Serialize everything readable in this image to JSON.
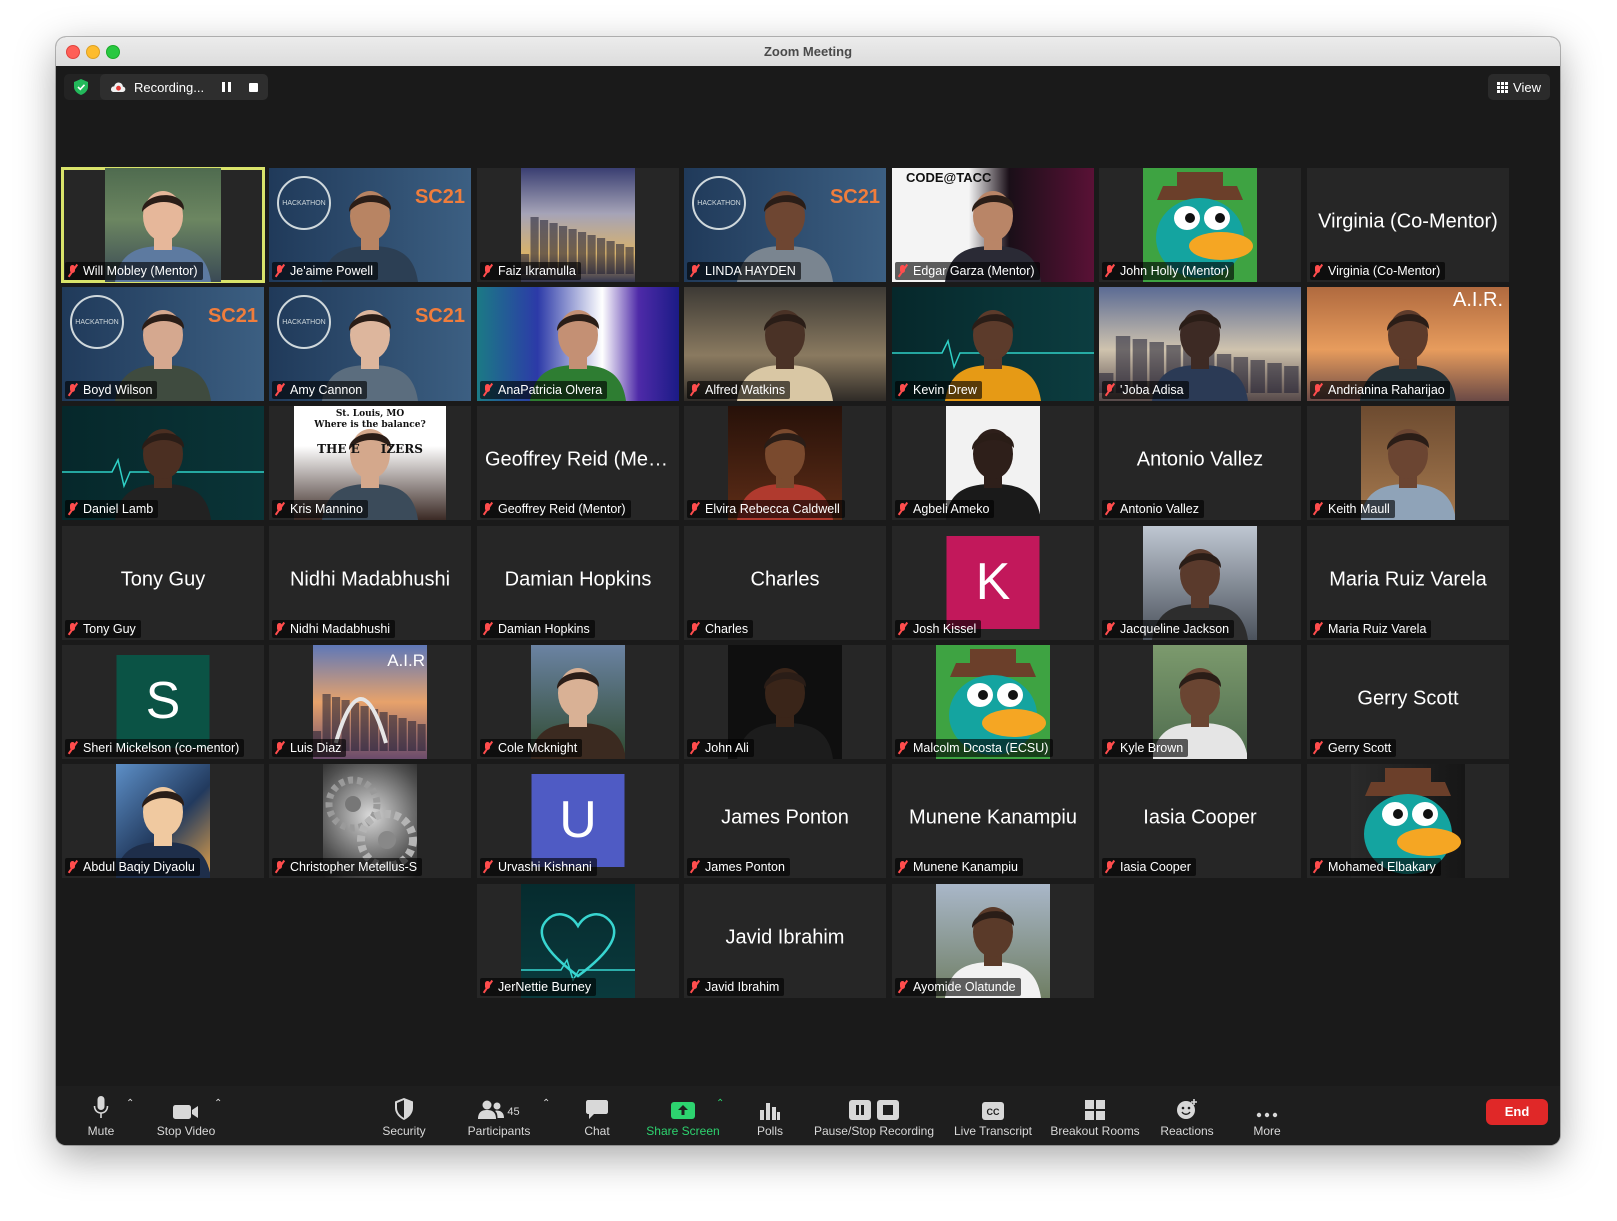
{
  "window": {
    "title": "Zoom Meeting"
  },
  "recording": {
    "label": "Recording..."
  },
  "view": {
    "label": "View"
  },
  "participants": [
    {
      "tile": "Will Mobley (Mentor)",
      "video": true
    },
    {
      "tile": "Je'aime Powell",
      "video": true
    },
    {
      "tile": "Faiz Ikramulla",
      "video": true
    },
    {
      "tile": "LINDA HAYDEN",
      "video": true
    },
    {
      "tile": "Edgar Garza (Mentor)",
      "video": true
    },
    {
      "tile": "John Holly (Mentor)",
      "video": true
    },
    {
      "tile": "Virginia (Co-Mentor)",
      "center": "Virginia (Co-Mentor)"
    },
    {
      "tile": "Boyd Wilson",
      "video": true
    },
    {
      "tile": "Amy Cannon",
      "video": true
    },
    {
      "tile": "AnaPatricia Olvera",
      "video": true
    },
    {
      "tile": "Alfred Watkins",
      "video": true
    },
    {
      "tile": "Kevin Drew",
      "video": true
    },
    {
      "tile": "'Joba Adisa",
      "video": true
    },
    {
      "tile": "Andrianina Raharijao",
      "video": true
    },
    {
      "tile": "Daniel Lamb",
      "video": true
    },
    {
      "tile": "Kris Mannino",
      "video": true
    },
    {
      "tile": "Geoffrey Reid (Mentor)",
      "center": "Geoffrey Reid (Men..."
    },
    {
      "tile": "Elvira Rebecca Caldwell",
      "video": true
    },
    {
      "tile": "Agbeli Ameko",
      "video": true
    },
    {
      "tile": "Antonio Vallez",
      "center": "Antonio Vallez"
    },
    {
      "tile": "Keith Maull",
      "video": true
    },
    {
      "tile": "Tony Guy",
      "center": "Tony Guy"
    },
    {
      "tile": "Nidhi Madabhushi",
      "center": "Nidhi Madabhushi"
    },
    {
      "tile": "Damian Hopkins",
      "center": "Damian Hopkins"
    },
    {
      "tile": "Charles",
      "center": "Charles"
    },
    {
      "tile": "Josh Kissel",
      "letter": "K",
      "color": "#c2185b"
    },
    {
      "tile": "Jacqueline Jackson",
      "video": true
    },
    {
      "tile": "Maria Ruiz Varela",
      "center": "Maria Ruiz Varela"
    },
    {
      "tile": "Sheri Mickelson (co-mentor)",
      "letter": "S",
      "color": "#0b5345"
    },
    {
      "tile": "Luis Diaz",
      "video": true
    },
    {
      "tile": "Cole Mcknight",
      "video": true
    },
    {
      "tile": "John Ali",
      "video": true
    },
    {
      "tile": "Malcolm Dcosta (ECSU)",
      "video": true
    },
    {
      "tile": "Kyle Brown",
      "video": true
    },
    {
      "tile": "Gerry Scott",
      "center": "Gerry Scott"
    },
    {
      "tile": "Abdul Baqiy Diyaolu",
      "video": true
    },
    {
      "tile": "Christopher Metellus-S",
      "video": true
    },
    {
      "tile": "Urvashi Kishnani",
      "letter": "U",
      "color": "#4f5bc4"
    },
    {
      "tile": "James Ponton",
      "center": "James Ponton"
    },
    {
      "tile": "Munene Kanampiu",
      "center": "Munene Kanampiu"
    },
    {
      "tile": "Iasia Cooper",
      "center": "Iasia Cooper"
    },
    {
      "tile": "Mohamed Elbakary",
      "video": true
    },
    {
      "tile": "JerNettie Burney",
      "video": true
    },
    {
      "tile": "Javid Ibrahim",
      "center": "Javid Ibrahim"
    },
    {
      "tile": "Ayomide Olatunde",
      "video": true
    }
  ],
  "backgrounds": {
    "sc21_text": "SC21",
    "hackathon_text": "HACKATHON",
    "codetacc_text": "CODE@TACC",
    "air_text": "A.I.R.",
    "air_text_short": "A.I.R",
    "kris_sign_line1": "St. Louis, MO",
    "kris_sign_line2": "Where is the balance?",
    "kris_sign_line3": "THE E     IZERS"
  },
  "toolbar": {
    "mute": "Mute",
    "stop_video": "Stop Video",
    "security": "Security",
    "participants": "Participants",
    "participants_count": "45",
    "chat": "Chat",
    "share_screen": "Share Screen",
    "polls": "Polls",
    "pause_stop_recording": "Pause/Stop Recording",
    "live_transcript": "Live Transcript",
    "breakout_rooms": "Breakout Rooms",
    "reactions": "Reactions",
    "more": "More",
    "end": "End"
  },
  "colors": {
    "accent_green": "#2dd36f",
    "end_red": "#e02828",
    "active_speaker": "#d9e36a"
  }
}
